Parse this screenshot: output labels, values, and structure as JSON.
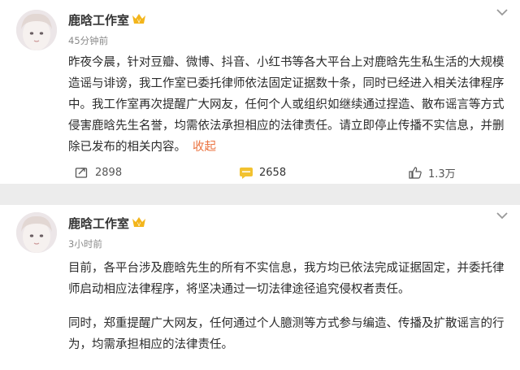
{
  "posts": [
    {
      "username": "鹿晗工作室",
      "time": "45分钟前",
      "paragraphs": [
        "昨夜今晨，针对豆瓣、微博、抖音、小红书等各大平台上对鹿晗先生私生活的大规模造谣与诽谤，我工作室已委托律师依法固定证据数十条，同时已经进入相关法律程序中。我工作室再次提醒广大网友，任何个人或组织如继续通过捏造、散布谣言等方式侵害鹿晗先生名誉，均需依法承担相应的法律责任。请立即停止传播不实信息，并删除已发布的相关内容。"
      ],
      "collapse_label": "收起",
      "actions": {
        "reposts": "2898",
        "comments": "2658",
        "likes": "1.3万"
      }
    },
    {
      "username": "鹿晗工作室",
      "time": "3小时前",
      "paragraphs": [
        "目前，各平台涉及鹿晗先生的所有不实信息，我方均已依法完成证据固定，并委托律师启动相应法律程序，将坚决通过一切法律途径追究侵权者责任。",
        "同时，郑重提醒广大网友，任何通过个人臆测等方式参与编造、传播及扩散谣言的行为，均需承担相应的法律责任。"
      ]
    }
  ],
  "colors": {
    "accent": "#eb7340",
    "vip_gold": "#f3b51b",
    "separator": "#ececec"
  },
  "icons": [
    "avatar",
    "vip-badge-icon",
    "chevron-down-icon",
    "repost-icon",
    "comment-icon",
    "like-icon"
  ]
}
